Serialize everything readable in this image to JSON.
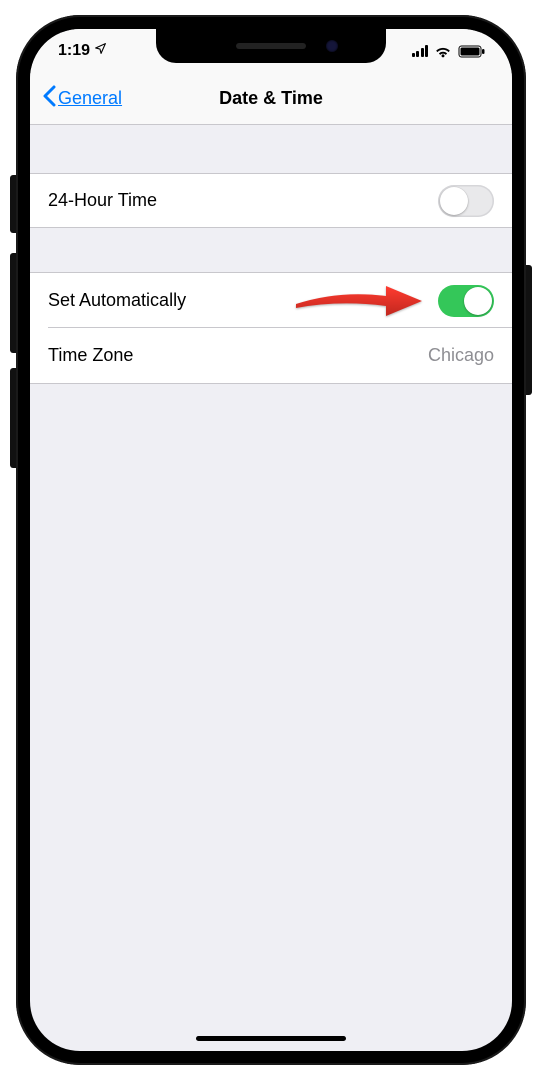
{
  "status": {
    "time": "1:19"
  },
  "nav": {
    "back_label": "General",
    "title": "Date & Time"
  },
  "group1": {
    "twenty_four_hour": {
      "label": "24-Hour Time",
      "on": false
    }
  },
  "group2": {
    "set_auto": {
      "label": "Set Automatically",
      "on": true
    },
    "time_zone": {
      "label": "Time Zone",
      "value": "Chicago"
    }
  }
}
